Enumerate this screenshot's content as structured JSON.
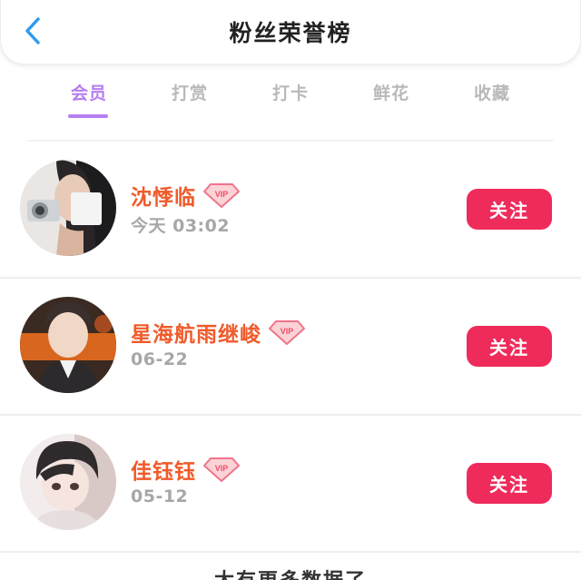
{
  "header": {
    "title": "粉丝荣誉榜",
    "back_icon": "chevron-left-icon"
  },
  "tabs": [
    {
      "label": "会员",
      "active": true
    },
    {
      "label": "打赏",
      "active": false
    },
    {
      "label": "打卡",
      "active": false
    },
    {
      "label": "鲜花",
      "active": false
    },
    {
      "label": "收藏",
      "active": false
    }
  ],
  "fans": [
    {
      "name": "沈悸临",
      "badge": "VIP",
      "time": "今天 03:02",
      "button": "关注"
    },
    {
      "name": "星海航雨继峻",
      "badge": "VIP",
      "time": "06-22",
      "button": "关注"
    },
    {
      "name": "佳钰钰",
      "badge": "VIP",
      "time": "05-12",
      "button": "关注"
    }
  ],
  "footer": {
    "text": "太有更多数据了"
  },
  "colors": {
    "accent_tab": "#b57ef0",
    "name": "#f05a2a",
    "follow_button": "#ef2b5b",
    "back_arrow": "#2e9bf0"
  }
}
